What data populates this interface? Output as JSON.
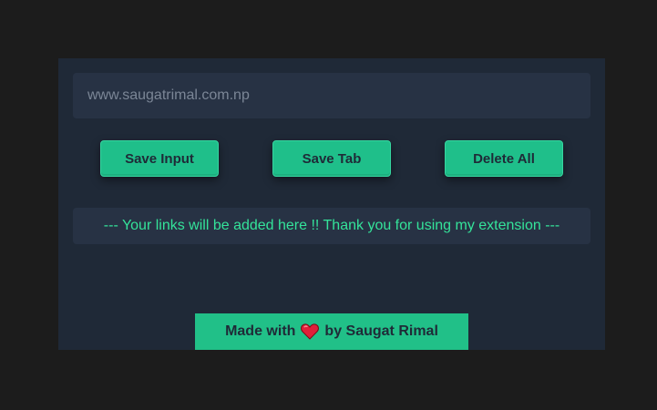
{
  "input": {
    "placeholder": "www.saugatrimal.com.np",
    "value": ""
  },
  "buttons": {
    "save_input": "Save Input",
    "save_tab": "Save Tab",
    "delete_all": "Delete All"
  },
  "links": {
    "empty_message": "--- Your links will be added here !! Thank you for using my extension ---"
  },
  "footer": {
    "prefix": "Made with",
    "heart_icon": "heart-icon",
    "suffix": "by Saugat Rimal"
  },
  "colors": {
    "accent": "#21c088",
    "panel_bg": "#1f2937",
    "field_bg": "#273244",
    "link_text": "#34e39a",
    "heart": "#e0203a"
  }
}
